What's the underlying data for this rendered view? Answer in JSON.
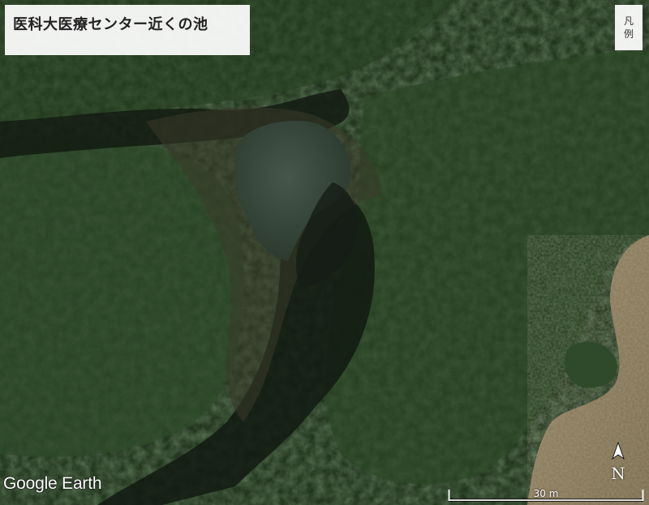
{
  "title": "医科大医療センター近くの池",
  "legend": {
    "label": "凡例"
  },
  "watermark": {
    "text": "Google Earth"
  },
  "compass": {
    "label": "N"
  },
  "scale_bar": {
    "label": "30 m"
  },
  "colors": {
    "forest_dark": "#1a2c18",
    "forest_mid": "#2f4a2a",
    "pond": "#3a4a3c",
    "shadow": "#141c16",
    "field": "#8a7a5e"
  }
}
